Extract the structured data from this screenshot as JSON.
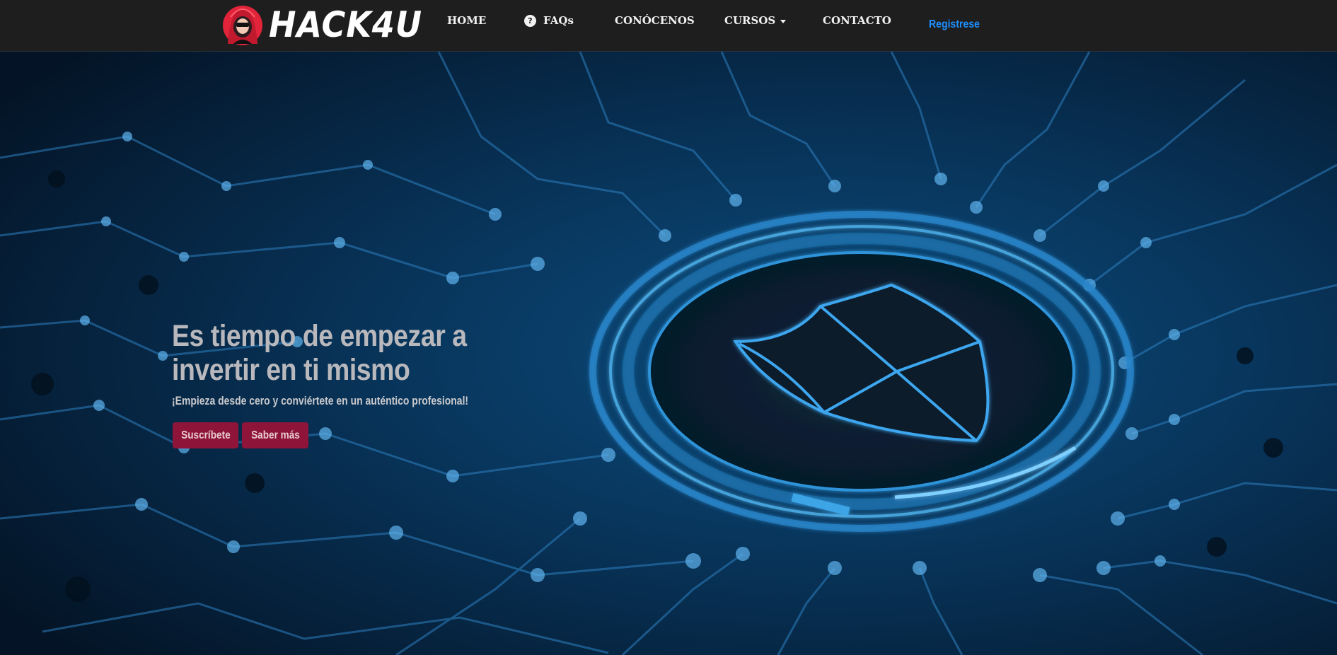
{
  "brand": {
    "name": "HACK4U",
    "logo_icon": "hooded-hacker-icon"
  },
  "nav": {
    "home": "HOME",
    "faqs": "FAQs",
    "faqs_icon": "question-circle-icon",
    "conocenos": "CONÓCENOS",
    "cursos": "CURSOS",
    "contacto": "CONTACTO",
    "register": "Registrese"
  },
  "hero": {
    "title": "Es tiempo de empezar a invertir en ti mismo",
    "subtitle": "¡Empieza desde cero y conviértete en un auténtico profesional!",
    "primary_button": "Suscríbete",
    "secondary_button": "Saber más",
    "background_icon": "circuit-shield-icon"
  },
  "colors": {
    "navbar": "#1e1e1f",
    "accent_button": "#8e1539",
    "register_link": "#1e90ff",
    "hero_glow": "#2b8fe0"
  }
}
